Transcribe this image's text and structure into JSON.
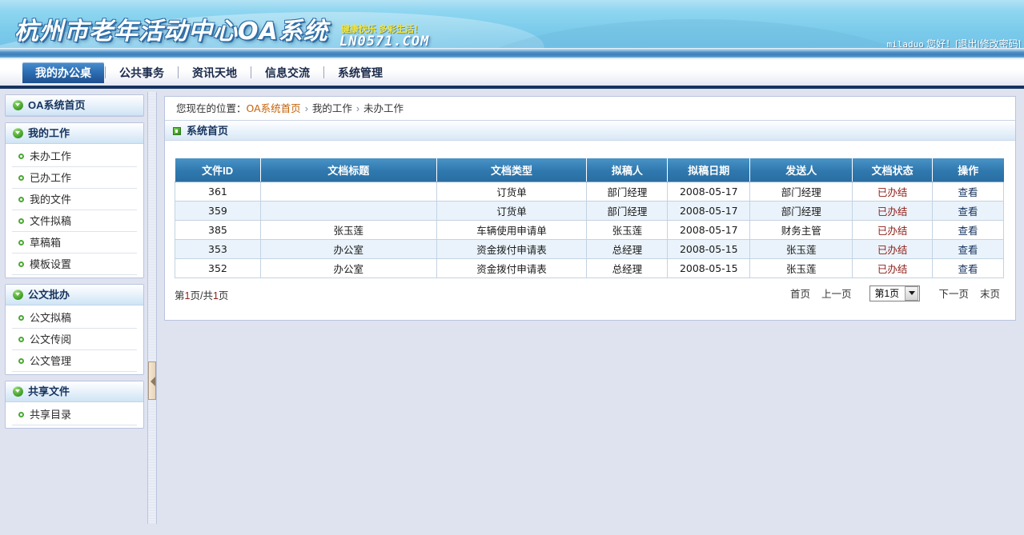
{
  "header": {
    "logo_title": "杭州市老年活动中心OA系统",
    "slogan": "健康快乐  多彩生活！",
    "domain": "LN0571.COM",
    "username": "miladuo",
    "greeting": "您好！[",
    "logout": "退出",
    "divider": "|",
    "change_password": "修改密码",
    "bracket_close": "]"
  },
  "nav": {
    "tabs": [
      {
        "label": "我的办公桌",
        "active": true
      },
      {
        "label": "公共事务",
        "active": false
      },
      {
        "label": "资讯天地",
        "active": false
      },
      {
        "label": "信息交流",
        "active": false
      },
      {
        "label": "系统管理",
        "active": false
      }
    ]
  },
  "sidebar": {
    "panels": [
      {
        "title": "OA系统首页",
        "items": []
      },
      {
        "title": "我的工作",
        "items": [
          "未办工作",
          "已办工作",
          "我的文件",
          "文件拟稿",
          "草稿箱",
          "模板设置"
        ]
      },
      {
        "title": "公文批办",
        "items": [
          "公文拟稿",
          "公文传阅",
          "公文管理"
        ]
      },
      {
        "title": "共享文件",
        "items": [
          "共享目录"
        ]
      }
    ]
  },
  "breadcrumb": {
    "prefix": "您现在的位置：",
    "home": "OA系统首页",
    "sep": "›",
    "level2": "我的工作",
    "level3": "未办工作"
  },
  "section": {
    "title": "系统首页"
  },
  "table": {
    "columns": [
      "文件ID",
      "文档标题",
      "文档类型",
      "拟稿人",
      "拟稿日期",
      "发送人",
      "文档状态",
      "操作"
    ],
    "rows": [
      {
        "id": "361",
        "title": "",
        "type": "订货单",
        "drafter": "部门经理",
        "date": "2008-05-17",
        "sender": "部门经理",
        "status": "已办结",
        "action": "查看"
      },
      {
        "id": "359",
        "title": "",
        "type": "订货单",
        "drafter": "部门经理",
        "date": "2008-05-17",
        "sender": "部门经理",
        "status": "已办结",
        "action": "查看"
      },
      {
        "id": "385",
        "title": "张玉莲",
        "type": "车辆使用申请单",
        "drafter": "张玉莲",
        "date": "2008-05-17",
        "sender": "财务主管",
        "status": "已办结",
        "action": "查看"
      },
      {
        "id": "353",
        "title": "办公室",
        "type": "资金拨付申请表",
        "drafter": "总经理",
        "date": "2008-05-15",
        "sender": "张玉莲",
        "status": "已办结",
        "action": "查看"
      },
      {
        "id": "352",
        "title": "办公室",
        "type": "资金拨付申请表",
        "drafter": "总经理",
        "date": "2008-05-15",
        "sender": "张玉莲",
        "status": "已办结",
        "action": "查看"
      }
    ]
  },
  "pager": {
    "summary_pre": "第",
    "current_page": "1",
    "summary_mid": "页/共",
    "total_pages": "1",
    "summary_post": "页",
    "first": "首页",
    "prev": "上一页",
    "selected_page": "第1页",
    "next": "下一页",
    "last": "末页"
  },
  "colors": {
    "banner_blue": "#79caea",
    "nav_active": "#2e6fb4",
    "table_header": "#2f78ae",
    "status_red": "#8d1d16",
    "breadcrumb_link": "#c4620a",
    "bullet_green": "#4aa832",
    "page_bg": "#dfe3f0"
  }
}
